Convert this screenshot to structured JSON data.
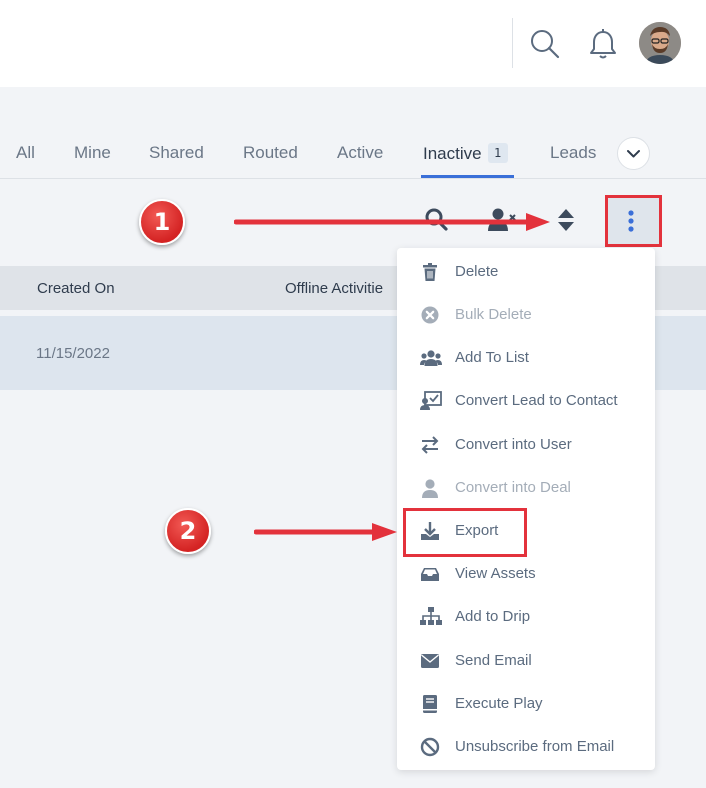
{
  "header": {
    "icons": [
      "search-icon",
      "bell-icon"
    ],
    "avatar": "user-avatar"
  },
  "tabs": [
    {
      "label": "All",
      "active": false
    },
    {
      "label": "Mine",
      "active": false
    },
    {
      "label": "Shared",
      "active": false
    },
    {
      "label": "Routed",
      "active": false
    },
    {
      "label": "Active",
      "active": false
    },
    {
      "label": "Inactive",
      "active": true,
      "badge": "1"
    },
    {
      "label": "Leads",
      "active": false
    }
  ],
  "toolbar": {
    "icons": [
      "search-icon",
      "user-filter-icon",
      "sort-icon",
      "more-options-icon"
    ]
  },
  "table": {
    "headers": [
      "Created On",
      "Offline Activitie"
    ],
    "rows": [
      {
        "created_on": "11/15/2022"
      }
    ]
  },
  "menu": {
    "items": [
      {
        "label": "Delete",
        "icon": "trash-icon",
        "disabled": false
      },
      {
        "label": "Bulk Delete",
        "icon": "close-circle-icon",
        "disabled": true
      },
      {
        "label": "Add To List",
        "icon": "users-icon",
        "disabled": false
      },
      {
        "label": "Convert Lead to Contact",
        "icon": "convert-contact-icon",
        "disabled": false
      },
      {
        "label": "Convert into User",
        "icon": "swap-icon",
        "disabled": false
      },
      {
        "label": "Convert into Deal",
        "icon": "user-icon",
        "disabled": true
      },
      {
        "label": "Export",
        "icon": "download-icon",
        "disabled": false
      },
      {
        "label": "View Assets",
        "icon": "inbox-icon",
        "disabled": false
      },
      {
        "label": "Add to Drip",
        "icon": "sitemap-icon",
        "disabled": false
      },
      {
        "label": "Send Email",
        "icon": "envelope-icon",
        "disabled": false
      },
      {
        "label": "Execute Play",
        "icon": "book-icon",
        "disabled": false
      },
      {
        "label": "Unsubscribe from Email",
        "icon": "ban-icon",
        "disabled": false
      }
    ]
  },
  "callouts": [
    "1",
    "2"
  ],
  "colors": {
    "accent": "#3a6fd8",
    "highlight": "#e3323c",
    "icon": "#5b6b7f"
  }
}
